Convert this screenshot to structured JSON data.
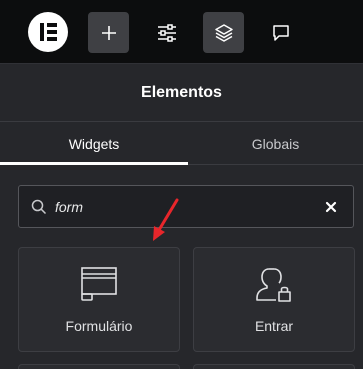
{
  "toolbar": {
    "logo_icon": "elementor-logo-icon",
    "buttons": [
      {
        "name": "add",
        "icon": "plus-icon"
      },
      {
        "name": "settings",
        "icon": "sliders-icon"
      },
      {
        "name": "navigator",
        "icon": "layers-icon",
        "active": true
      },
      {
        "name": "notes",
        "icon": "chat-bubble-icon"
      }
    ]
  },
  "panel": {
    "title": "Elementos"
  },
  "tabs": [
    {
      "label": "Widgets",
      "active": true
    },
    {
      "label": "Globais",
      "active": false
    }
  ],
  "search": {
    "value": "form",
    "placeholder": "",
    "clear_icon": "close-icon"
  },
  "widgets": [
    {
      "label": "Formulário",
      "icon": "form-icon"
    },
    {
      "label": "Entrar",
      "icon": "user-lock-icon"
    }
  ],
  "colors": {
    "toolbar_bg": "#0c0d0e",
    "panel_bg": "#26272b",
    "card_bg": "#2b2c30",
    "annotation_arrow": "#e8262b"
  }
}
